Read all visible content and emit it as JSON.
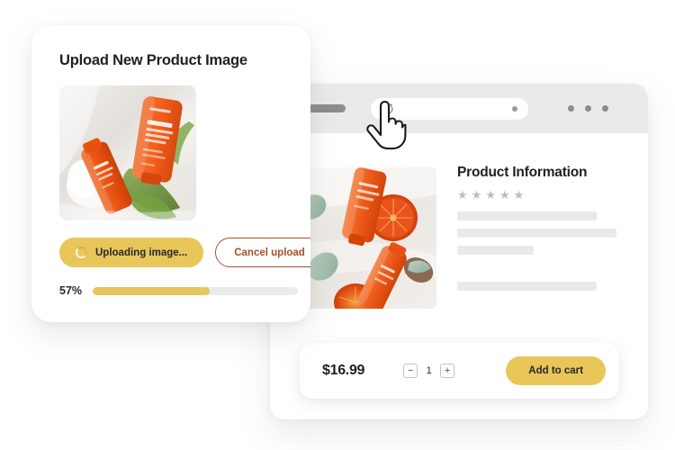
{
  "upload_card": {
    "title": "Upload New Product Image",
    "thumbnail_alt": "orange-cosmetic-tubes-with-tulip-photo",
    "uploading_button": {
      "label": "Uploading image...",
      "icon": "spinner-icon"
    },
    "cancel_button": {
      "label": "Cancel upload"
    },
    "progress": {
      "percent_label": "57%",
      "percent_value": 57
    }
  },
  "browser": {
    "chrome": {
      "nav_pill": "nav-pill",
      "reload_icon": "reload-icon",
      "address_dot": "address-dot",
      "menu_dots": [
        "menu-dot",
        "menu-dot",
        "menu-dot"
      ]
    },
    "product_photo_alt": "orange-skincare-tubes-with-citrus-slices-photo",
    "product": {
      "heading": "Product Information",
      "rating_stars": [
        "★",
        "★",
        "★",
        "★",
        "★"
      ],
      "rating_value": 5,
      "skeleton_lines": [
        155,
        177,
        85,
        155
      ]
    },
    "cart": {
      "price": "$16.99",
      "decrement_label": "−",
      "quantity": "1",
      "increment_label": "+",
      "add_to_cart_label": "Add to cart"
    }
  },
  "cursor": {
    "type": "pointing-hand-cursor"
  },
  "colors": {
    "accent_yellow": "#e8c659",
    "accent_brown": "#a5502a",
    "text_dark": "#1f2024",
    "skeleton_gray": "#e9e9e9",
    "chrome_gray": "#eaeaea"
  }
}
